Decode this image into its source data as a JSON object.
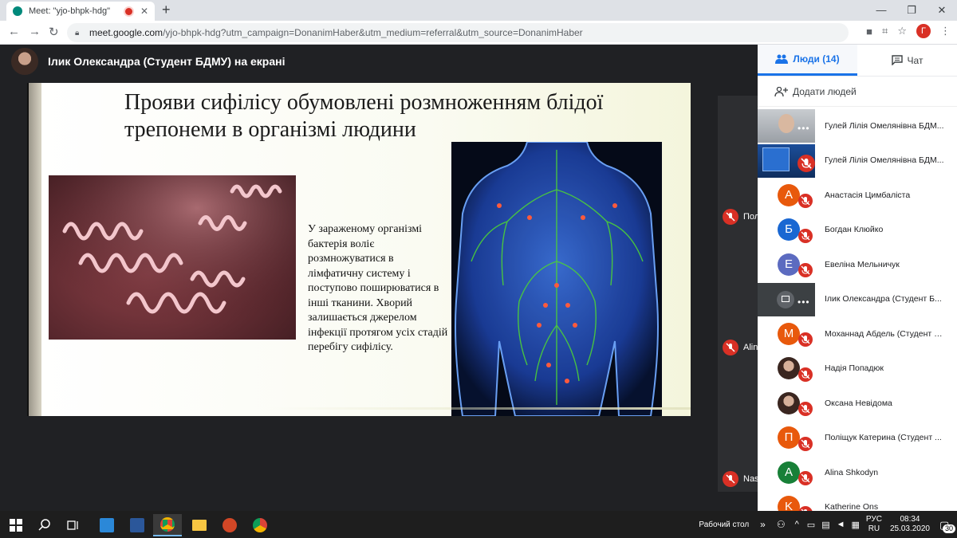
{
  "browser": {
    "tab_title": "Meet: \"yjo-bhpk-hdg\"",
    "url_host": "meet.google.com",
    "url_path": "/yjo-bhpk-hdg?utm_campaign=DonanimHaber&utm_medium=referral&utm_source=DonanimHaber",
    "profile_initial": "Г"
  },
  "meet": {
    "presenter_label": "Ілик Олександра (Студент БДМУ) на екрані",
    "side_tiles": [
      "Пол",
      "Alin",
      "Nas"
    ]
  },
  "slide": {
    "title": "Прояви сифілісу обумовлені розмноженням блідої трепонеми в організмі людини",
    "body": "У зараженому організмі бактерія воліє розмножуватися в лімфатичну систему і поступово поширюватися в інші тканини. Хворий залишається джерелом інфекції протягом усіх стадій перебігу сифілісу."
  },
  "panel": {
    "people_tab": "Люди (14)",
    "chat_tab": "Чат",
    "add_people": "Додати людей",
    "participants": [
      {
        "name": "Гулей Лілія Омелянівна БДМ...",
        "kind": "video",
        "status": "dots"
      },
      {
        "name": "Гулей Лілія Омелянівна БДМ...",
        "kind": "screen",
        "status": "muted"
      },
      {
        "name": "Анастасія Цимбаліста",
        "kind": "initial",
        "initial": "А",
        "color": "#e8590c",
        "status": "muted"
      },
      {
        "name": "Богдан Клюйко",
        "kind": "initial",
        "initial": "Б",
        "color": "#1967d2",
        "status": "muted"
      },
      {
        "name": "Евеліна Мельничук",
        "kind": "initial",
        "initial": "Е",
        "color": "#5c6bc0",
        "status": "muted"
      },
      {
        "name": "Ілик Олександра (Студент Б...",
        "kind": "present",
        "status": "dots"
      },
      {
        "name": "Моханнад Абдель (Студент - ...",
        "kind": "initial",
        "initial": "М",
        "color": "#e8590c",
        "status": "muted"
      },
      {
        "name": "Надія Попадюк",
        "kind": "photo",
        "status": "muted"
      },
      {
        "name": "Оксана Невідома",
        "kind": "photo",
        "status": "muted"
      },
      {
        "name": "Поліщук Катерина (Студент ...",
        "kind": "initial",
        "initial": "П",
        "color": "#e8590c",
        "status": "muted"
      },
      {
        "name": "Alina Shkodyn",
        "kind": "initial",
        "initial": "A",
        "color": "#188038",
        "status": "muted"
      },
      {
        "name": "Katherine Ons",
        "kind": "initial",
        "initial": "K",
        "color": "#e8590c",
        "status": "muted"
      }
    ]
  },
  "taskbar": {
    "desktop_label": "Рабочий стол",
    "lang_top": "РУС",
    "lang_bottom": "RU",
    "time": "08:34",
    "date": "25.03.2020",
    "notifications": "30"
  }
}
